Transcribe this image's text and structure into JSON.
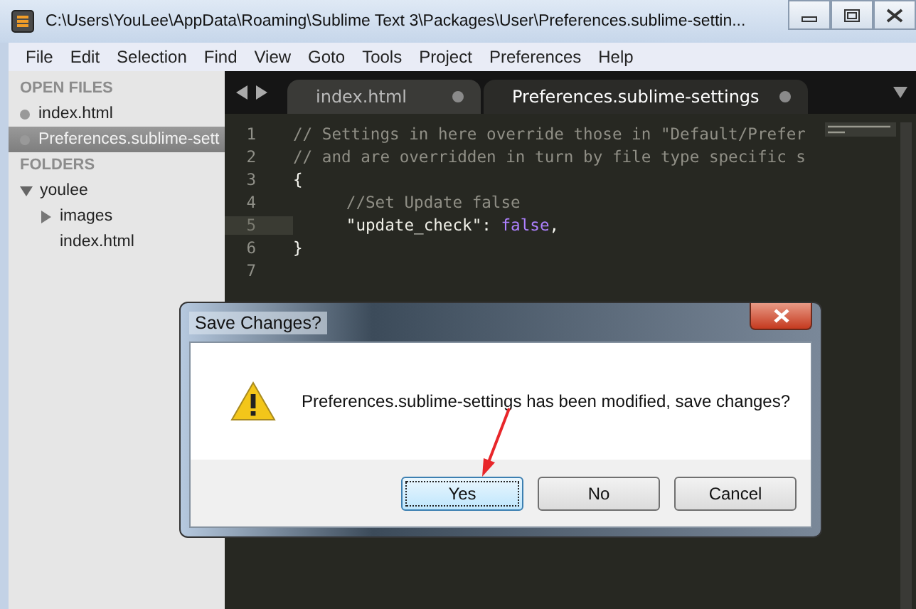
{
  "window": {
    "title": "C:\\Users\\YouLee\\AppData\\Roaming\\Sublime Text 3\\Packages\\User\\Preferences.sublime-settin..."
  },
  "menu": [
    "File",
    "Edit",
    "Selection",
    "Find",
    "View",
    "Goto",
    "Tools",
    "Project",
    "Preferences",
    "Help"
  ],
  "sidebar": {
    "open_files_heading": "OPEN FILES",
    "open_files": [
      {
        "label": "index.html",
        "selected": false
      },
      {
        "label": "Preferences.sublime-sett",
        "selected": true
      }
    ],
    "folders_heading": "FOLDERS",
    "folders": [
      {
        "label": "youlee",
        "kind": "folder",
        "expanded": true,
        "children": [
          {
            "label": "images",
            "kind": "folder",
            "expanded": false
          },
          {
            "label": "index.html",
            "kind": "file"
          }
        ]
      }
    ]
  },
  "tabs": [
    {
      "label": "index.html",
      "selected": false
    },
    {
      "label": "Preferences.sublime-settings",
      "selected": true
    }
  ],
  "code": [
    {
      "number": "1",
      "current": false,
      "tokens": [
        {
          "kind": "comment",
          "text": "// Settings in here override those in \"Default/Prefer"
        }
      ]
    },
    {
      "number": "2",
      "current": false,
      "tokens": [
        {
          "kind": "comment",
          "text": "// and are overridden in turn by file type specific s"
        }
      ]
    },
    {
      "number": "3",
      "current": false,
      "tokens": [
        {
          "kind": "plain",
          "text": "{"
        }
      ]
    },
    {
      "number": "4",
      "current": false,
      "indented": true,
      "tokens": [
        {
          "kind": "comment",
          "text": "//Set Update false"
        }
      ]
    },
    {
      "number": "5",
      "current": true,
      "indented": true,
      "tokens": [
        {
          "kind": "string",
          "text": "\"update_check\""
        },
        {
          "kind": "plain",
          "text": ": "
        },
        {
          "kind": "constant",
          "text": "false"
        },
        {
          "kind": "plain",
          "text": ","
        }
      ]
    },
    {
      "number": "6",
      "current": false,
      "tokens": [
        {
          "kind": "plain",
          "text": "}"
        }
      ]
    },
    {
      "number": "7",
      "current": false
    }
  ],
  "dialog": {
    "title": "Save Changes?",
    "message": "Preferences.sublime-settings has been modified, save changes?",
    "buttons": [
      {
        "label": "Yes",
        "selected": true
      },
      {
        "label": "No",
        "selected": false
      },
      {
        "label": "Cancel",
        "selected": false
      }
    ]
  }
}
